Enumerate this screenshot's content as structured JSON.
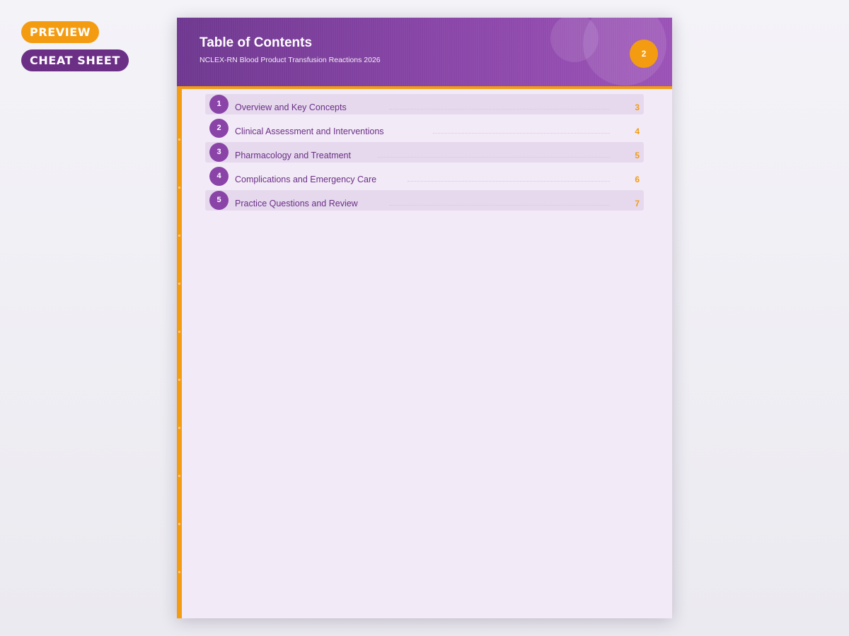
{
  "badges": {
    "preview": "PREVIEW",
    "cheat_sheet": "CHEAT SHEET"
  },
  "header": {
    "title": "Table of Contents",
    "subtitle": "NCLEX-RN Blood Product Transfusion Reactions 2026",
    "page_number": "2"
  },
  "toc": [
    {
      "num": "1",
      "label": "Overview and Key Concepts",
      "page": "3"
    },
    {
      "num": "2",
      "label": "Clinical Assessment and Interventions",
      "page": "4"
    },
    {
      "num": "3",
      "label": "Pharmacology and Treatment",
      "page": "5"
    },
    {
      "num": "4",
      "label": "Complications and Emergency Care",
      "page": "6"
    },
    {
      "num": "5",
      "label": "Practice Questions and Review",
      "page": "7"
    }
  ],
  "colors": {
    "accent": "#f39c12",
    "primary": "#8a44a8",
    "dark_primary": "#6b2f86",
    "page_background": "#f3eaf7"
  }
}
